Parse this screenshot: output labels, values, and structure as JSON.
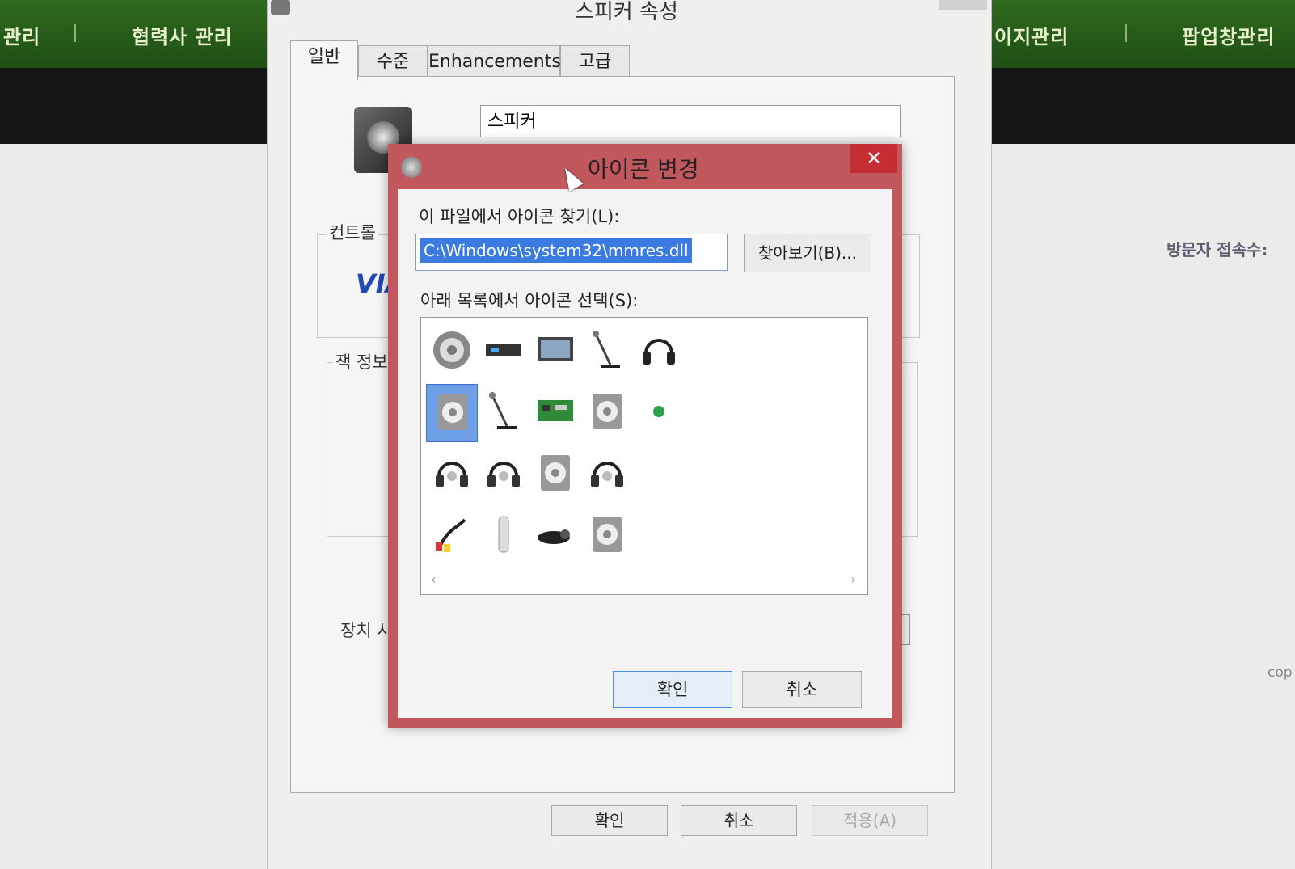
{
  "site": {
    "nav": [
      "관리",
      "협력사 관리",
      "이지관리",
      "팝업창관리"
    ],
    "visitor_label": "방문자 접속수:",
    "copyright_fragment": "cop"
  },
  "properties_window": {
    "title": "스피커 속성",
    "tabs": [
      "일반",
      "수준",
      "Enhancements",
      "고급"
    ],
    "device_name": "스피커",
    "controller_label": "컨트롤",
    "jack_info_label": "잭 정보",
    "device_usage_label": "장치 사",
    "buttons": {
      "ok": "확인",
      "cancel": "취소",
      "apply": "적용(A)"
    }
  },
  "change_icon_dialog": {
    "title": "아이콘 변경",
    "close_glyph": "✕",
    "find_label": "이 파일에서 아이콘 찾기(L):",
    "path_value": "C:\\Windows\\system32\\mmres.dll",
    "browse_label": "찾아보기(B)...",
    "select_label": "아래 목록에서 아이콘 선택(S):",
    "icons": [
      {
        "name": "speaker-cone-icon"
      },
      {
        "name": "receiver-icon"
      },
      {
        "name": "monitor-icon"
      },
      {
        "name": "microphone-stand-icon"
      },
      {
        "name": "headphones-icon"
      },
      {
        "name": "speaker-box-icon",
        "selected": true
      },
      {
        "name": "microphone-stand-icon"
      },
      {
        "name": "sound-card-icon"
      },
      {
        "name": "speaker-box-icon"
      },
      {
        "name": "green-dot-icon"
      },
      {
        "name": "headset-icon"
      },
      {
        "name": "headset-icon"
      },
      {
        "name": "speaker-box-icon"
      },
      {
        "name": "headset-icon"
      },
      {
        "name": "rca-cable-icon"
      },
      {
        "name": "phone-handset-icon"
      },
      {
        "name": "webcam-headset-icon"
      },
      {
        "name": "speaker-box-icon"
      }
    ],
    "ok_label": "확인",
    "cancel_label": "취소"
  }
}
